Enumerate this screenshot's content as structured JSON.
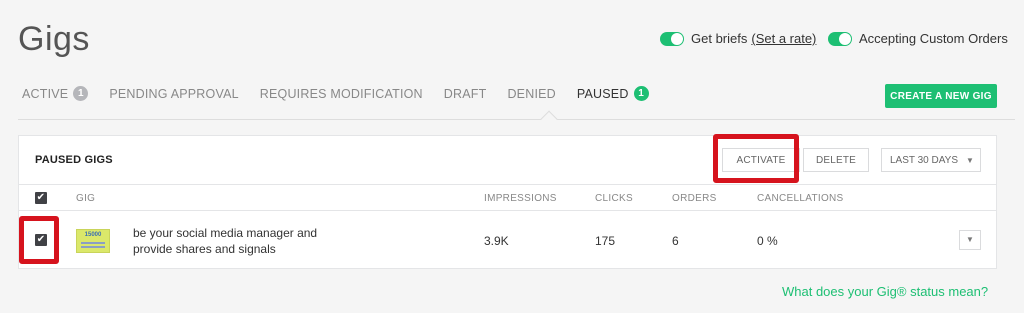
{
  "header": {
    "title": "Gigs",
    "toggles": [
      {
        "label": "Get briefs",
        "link": "(Set a rate)",
        "on": true
      },
      {
        "label": "Accepting Custom Orders",
        "on": true
      }
    ],
    "create_button": "CREATE A NEW GIG"
  },
  "tabs": [
    {
      "label": "ACTIVE",
      "badge": "1"
    },
    {
      "label": "PENDING APPROVAL"
    },
    {
      "label": "REQUIRES MODIFICATION"
    },
    {
      "label": "DRAFT"
    },
    {
      "label": "DENIED"
    },
    {
      "label": "PAUSED",
      "badge": "1",
      "active": true
    }
  ],
  "panel": {
    "title": "PAUSED GIGS",
    "activate_label": "ACTIVATE",
    "delete_label": "DELETE",
    "range": "LAST 30 DAYS",
    "columns": [
      "GIG",
      "IMPRESSIONS",
      "CLICKS",
      "ORDERS",
      "CANCELLATIONS"
    ],
    "rows": [
      {
        "thumb_text": "15000",
        "title": "be your social media manager and provide shares and signals",
        "impressions": "3.9K",
        "clicks": "175",
        "orders": "6",
        "cancellations": "0 %",
        "checked": true
      }
    ]
  },
  "help_link": "What does your Gig® status mean?",
  "colors": {
    "accent": "#1dbf73",
    "highlight": "#d6131d",
    "checkbox": "#404145"
  }
}
